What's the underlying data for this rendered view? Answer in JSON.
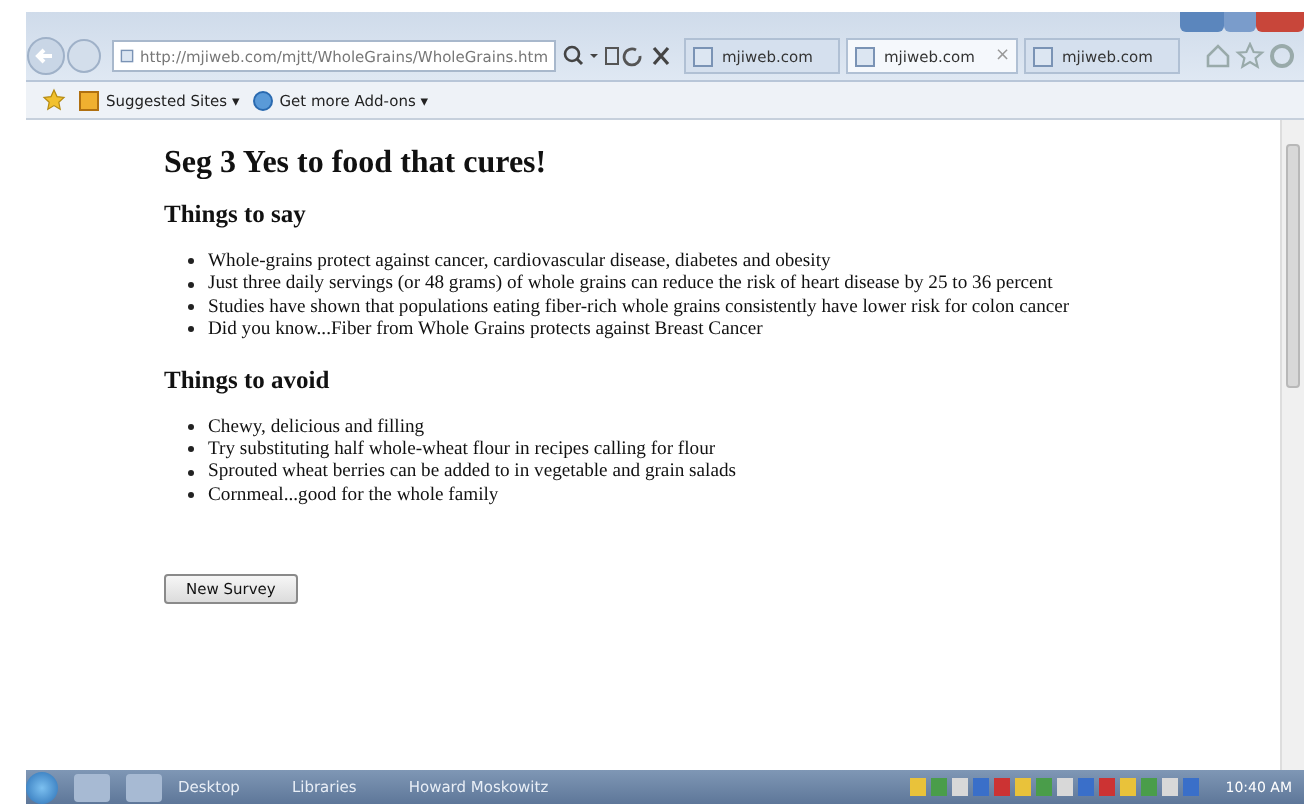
{
  "browser": {
    "address": "http://mjiweb.com/mjtt/WholeGrains/WholeGrains.htm",
    "tabs": [
      {
        "label": "mjiweb.com",
        "selected": false
      },
      {
        "label": "mjiweb.com",
        "selected": true,
        "close": "×"
      },
      {
        "label": "mjiweb.com",
        "selected": false
      }
    ],
    "favorites": [
      {
        "label": "Suggested Sites ▾"
      },
      {
        "label": "Get more Add-ons ▾"
      }
    ]
  },
  "page": {
    "title": "Seg 3 Yes to food that cures!",
    "sections": [
      {
        "heading": "Things to say",
        "items": [
          "Whole-grains protect against cancer, cardiovascular disease, diabetes and obesity",
          "Just three daily servings (or 48 grams) of whole grains can reduce the risk of heart disease by 25 to 36 percent",
          "Studies have shown that populations eating fiber-rich whole grains consistently have lower risk for colon cancer",
          "Did you know...Fiber from Whole Grains protects against Breast Cancer"
        ]
      },
      {
        "heading": "Things to avoid",
        "items": [
          "Chewy, delicious and filling",
          "Try substituting half whole-wheat flour in recipes calling for flour",
          "Sprouted wheat berries can be added to in vegetable and grain salads",
          "Cornmeal...good for the whole family"
        ]
      }
    ],
    "button": "New Survey"
  },
  "taskbar": {
    "items": [
      {
        "label": "Desktop"
      },
      {
        "label": "Libraries"
      },
      {
        "label": "Howard Moskowitz"
      }
    ],
    "clock": "10:40 AM"
  }
}
